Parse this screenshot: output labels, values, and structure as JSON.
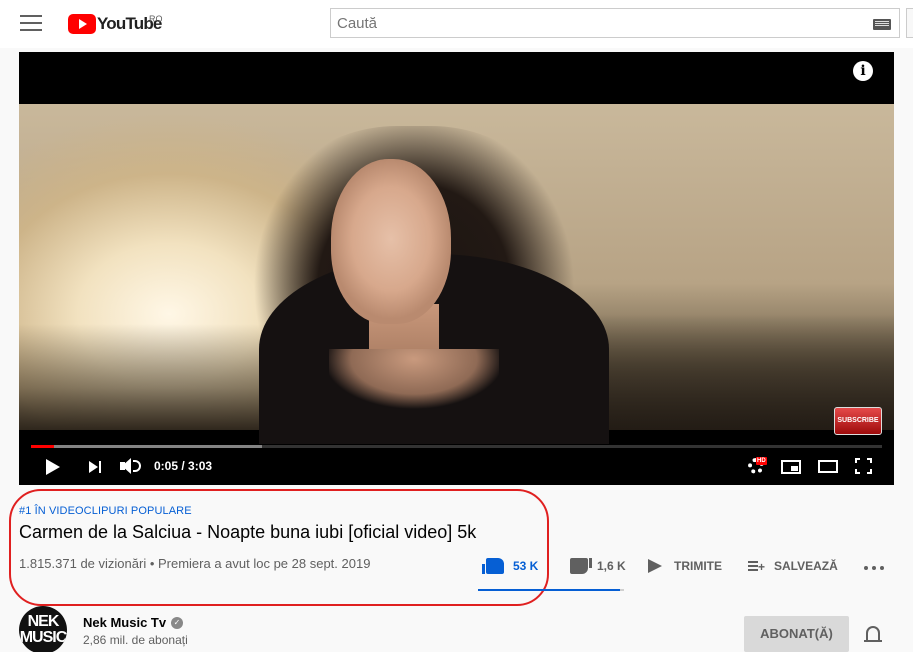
{
  "header": {
    "logo_text": "YouTube",
    "region": "RO",
    "search_placeholder": "Caută"
  },
  "player": {
    "current_time": "0:05",
    "duration": "3:03",
    "time_display": "0:05 / 3:03",
    "played_fraction": 0.027,
    "buffered_fraction": 0.272,
    "info_glyph": "i",
    "subscribe_overlay": "SUBSCRIBE",
    "hd_badge": "HD",
    "accent_color": "#ff0000"
  },
  "video": {
    "trending_badge": "#1 ÎN VIDEOCLIPURI POPULARE",
    "title": "Carmen de la Salciua - Noapte buna iubi [oficial video] 5k",
    "meta": "1.815.371 de vizionări • Premiera a avut loc pe 28 sept. 2019"
  },
  "actions": {
    "likes": "53 K",
    "dislikes": "1,6 K",
    "share": "TRIMITE",
    "save": "SALVEAZĂ",
    "like_ratio": 0.97,
    "link_color": "#065fd4"
  },
  "channel": {
    "avatar_text": "NEK MUSIC",
    "name": "Nek Music Tv",
    "verified_glyph": "✓",
    "subscribers": "2,86 mil. de abonați",
    "subscribe_state": "ABONAT(Ă)"
  },
  "icons": [
    "menu-icon",
    "youtube-logo",
    "keyboard-icon",
    "info-icon",
    "play-icon",
    "next-icon",
    "volume-icon",
    "settings-icon",
    "miniplayer-icon",
    "theater-icon",
    "fullscreen-icon",
    "like-icon",
    "dislike-icon",
    "share-icon",
    "save-icon",
    "more-icon",
    "verified-icon",
    "bell-icon"
  ]
}
